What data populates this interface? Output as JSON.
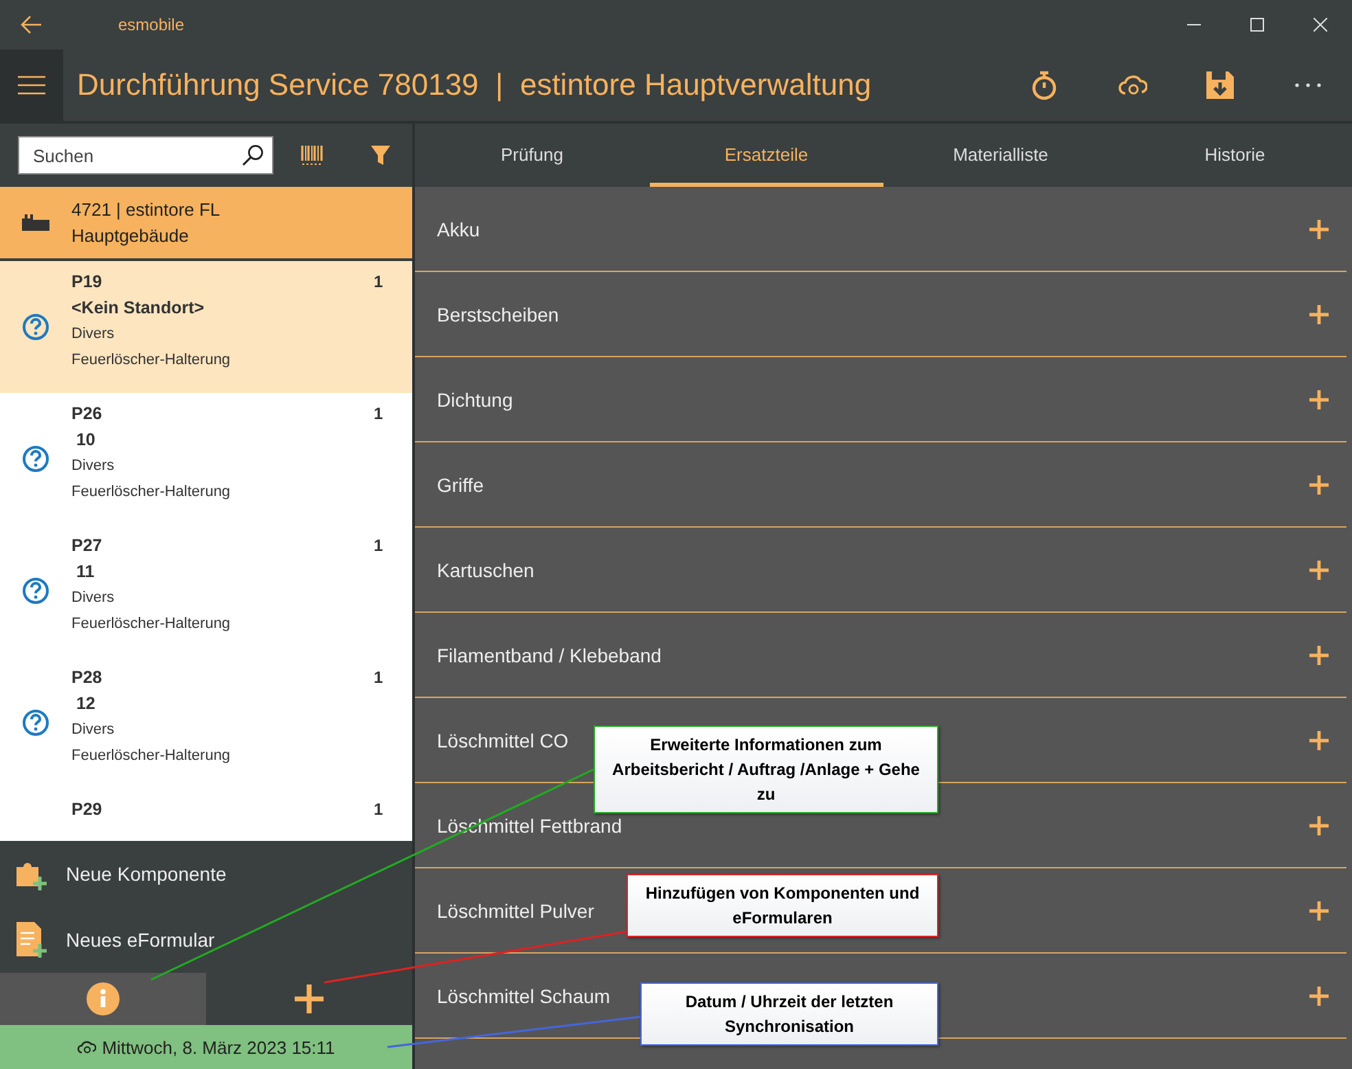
{
  "window": {
    "title": "esmobile"
  },
  "header": {
    "title": "Durchführung Service 780139  |  estintore Hauptverwaltung"
  },
  "search": {
    "placeholder": "Suchen"
  },
  "site": {
    "line_1": "4721  |  estintore FL",
    "line_2": "Hauptgebäude"
  },
  "components": [
    {
      "name": "P19",
      "location": "<Kein Standort>",
      "category": "Divers",
      "type": "Feuerlöscher-Halterung",
      "count": "1",
      "selected": true
    },
    {
      "name": "P26",
      "location": " 10",
      "category": "Divers",
      "type": "Feuerlöscher-Halterung",
      "count": "1",
      "selected": false
    },
    {
      "name": "P27",
      "location": " 11",
      "category": "Divers",
      "type": "Feuerlöscher-Halterung",
      "count": "1",
      "selected": false
    },
    {
      "name": "P28",
      "location": " 12",
      "category": "Divers",
      "type": "Feuerlöscher-Halterung",
      "count": "1",
      "selected": false
    },
    {
      "name": "P29",
      "count": "1",
      "selected": false
    }
  ],
  "add_menu": [
    {
      "kind": "component",
      "label": "Neue Komponente"
    },
    {
      "kind": "form",
      "label": "Neues eFormular"
    }
  ],
  "bottom_tabs": [
    {
      "kind": "info",
      "selected": true
    },
    {
      "kind": "add",
      "selected": false
    }
  ],
  "status_bar": {
    "sync_time": "Mittwoch, 8. März 2023 15:11"
  },
  "tabs": [
    {
      "label": "Prüfung",
      "selected": false
    },
    {
      "label": "Ersatzteile",
      "selected": true
    },
    {
      "label": "Materialliste",
      "selected": false
    },
    {
      "label": "Historie",
      "selected": false
    }
  ],
  "categories": [
    "Akku",
    "Berstscheiben",
    "Dichtung",
    "Griffe",
    "Kartuschen",
    "Filamentband / Klebeband",
    "Löschmittel CO",
    "Löschmittel Fettbrand",
    "Löschmittel Pulver",
    "Löschmittel Schaum"
  ],
  "callouts": [
    {
      "text": "Erweiterte Informationen zum Arbeitsbericht / Auftrag /Anlage + Gehe zu",
      "color": "#22aa22"
    },
    {
      "text": "Hinzufügen von Komponenten und eFormularen",
      "color": "#dd2222"
    },
    {
      "text": "Datum / Uhrzeit der letzten Synchronisation",
      "color": "#4466dd"
    }
  ]
}
